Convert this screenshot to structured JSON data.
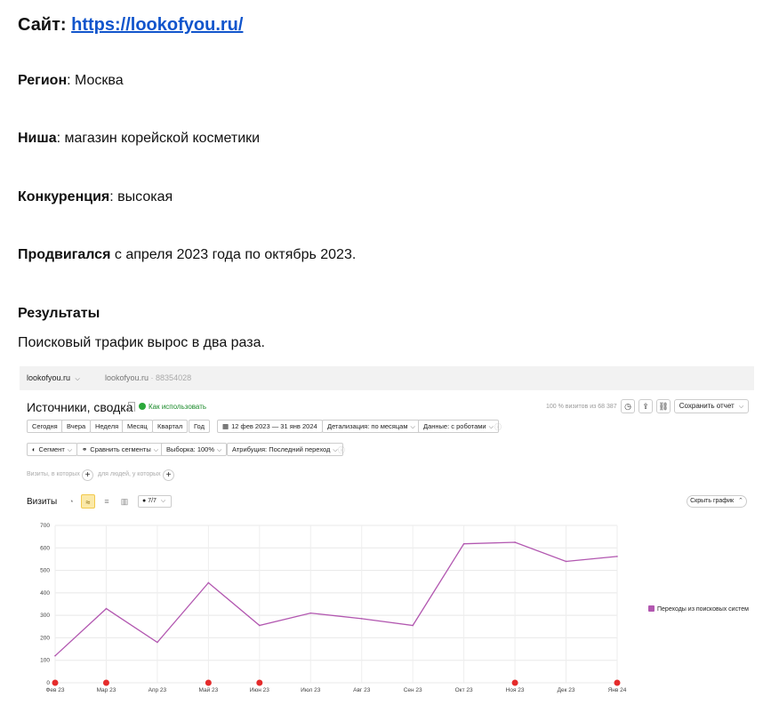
{
  "doc": {
    "site_label": "Сайт:",
    "site_url": "https://lookofyou.ru/",
    "region_label": "Регион",
    "region_value": ": Москва",
    "niche_label": "Ниша",
    "niche_value": ": магазин корейской косметики",
    "competition_label": "Конкуренция",
    "competition_value": ": высокая",
    "promo_label": "Продвигался",
    "promo_value": " с апреля 2023 года по октябрь 2023.",
    "results_heading": "Результаты",
    "results_text": "Поисковый трафик вырос в два раза."
  },
  "metrica": {
    "top": {
      "site": "lookofyou.ru",
      "counter_name": "lookofyou.ru",
      "counter_id": "· 88354028"
    },
    "title": "Источники, сводка",
    "howto": "Как использовать",
    "visits_note": "100 % визитов из 68 387",
    "save_button": "Сохранить отчет",
    "periods": [
      "Сегодня",
      "Вчера",
      "Неделя",
      "Месяц",
      "Квартал",
      "Год"
    ],
    "date_range": "12 фев 2023 — 31 янв 2024",
    "detail": "Детализация: по месяцам",
    "data_filter": "Данные: с роботами",
    "segment": "Сегмент",
    "compare": "Сравнить сегменты",
    "sample": "Выборка: 100%",
    "attribution": "Атрибуция: Последний переход",
    "hint_visits": "Визиты, в которых",
    "hint_people": "для людей, у которых",
    "visits_label": "Визиты",
    "metrics_count": "7/7",
    "hide_chart": "Скрыть график",
    "icons": [
      "clock-icon",
      "export-icon",
      "link-icon",
      "pie-icon",
      "line-icon",
      "area-icon",
      "bar-icon"
    ]
  },
  "chart_data": {
    "type": "line",
    "categories": [
      "Фев 23",
      "Мар 23",
      "Апр 23",
      "Май 23",
      "Июн 23",
      "Июл 23",
      "Авг 23",
      "Сен 23",
      "Окт 23",
      "Ноя 23",
      "Дек 23",
      "Янв 24"
    ],
    "series": [
      {
        "name": "Переходы из поисковых систем",
        "values": [
          120,
          330,
          180,
          445,
          255,
          310,
          285,
          255,
          618,
          625,
          540,
          562
        ]
      }
    ],
    "ylim": [
      0,
      700
    ],
    "yticks": [
      0,
      100,
      200,
      300,
      400,
      500,
      600,
      700
    ],
    "color": "#b257b0",
    "grid": true,
    "legend": "right",
    "annotation_markers": [
      0,
      1,
      3,
      4,
      9,
      11
    ]
  }
}
